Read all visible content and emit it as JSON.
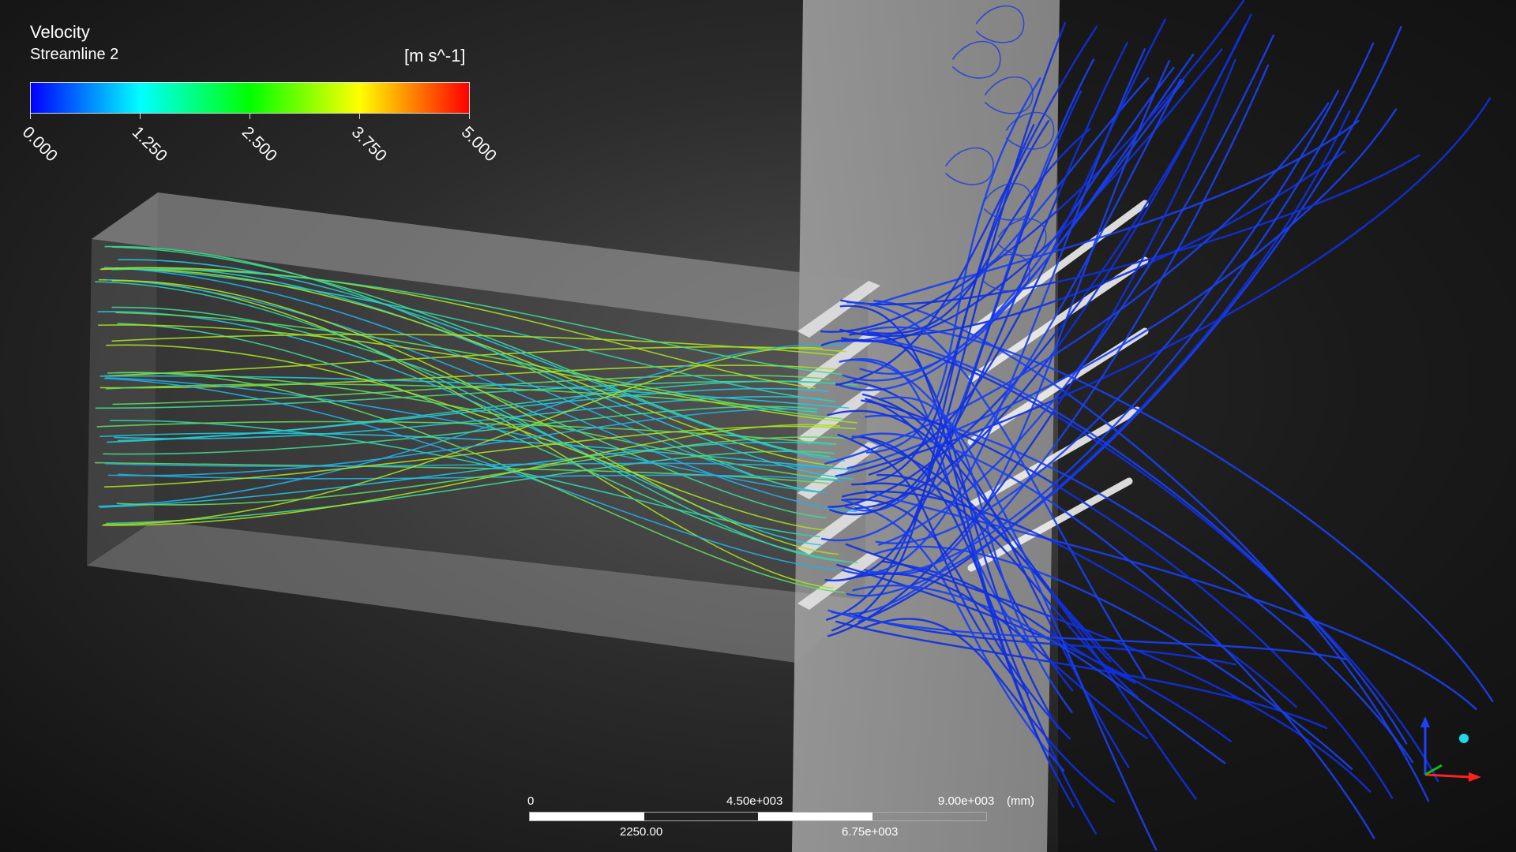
{
  "legend": {
    "title": "Velocity",
    "subtitle": "Streamline 2",
    "units": "[m s^-1]",
    "ticks": [
      "0.000",
      "1.250",
      "2.500",
      "3.750",
      "5.000"
    ],
    "colormap": [
      "#0000ff",
      "#00ffff",
      "#00ff00",
      "#ffff00",
      "#ff0000"
    ]
  },
  "scale_bar": {
    "top_labels": [
      "0",
      "4.50e+003",
      "9.00e+003"
    ],
    "bottom_labels": [
      "2250.00",
      "6.75e+003"
    ],
    "unit": "(mm)"
  },
  "axes_colors": {
    "x": "#ff2020",
    "y": "#10c010",
    "z": "#2040ff"
  }
}
